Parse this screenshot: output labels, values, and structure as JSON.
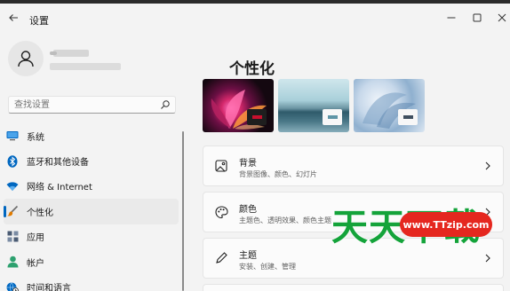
{
  "window": {
    "title": "设置",
    "back_icon": "back-arrow-icon",
    "minimize_icon": "minimize-icon",
    "maximize_icon": "maximize-icon",
    "close_icon": "close-icon"
  },
  "search": {
    "placeholder": "查找设置",
    "icon": "search-icon"
  },
  "sidebar": {
    "items": [
      {
        "label": "系统",
        "icon": "monitor-icon",
        "color": "#0067c0"
      },
      {
        "label": "蓝牙和其他设备",
        "icon": "bluetooth-icon",
        "color": "#0067c0"
      },
      {
        "label": "网络 & Internet",
        "icon": "wifi-icon",
        "color": "#0067c0"
      },
      {
        "label": "个性化",
        "icon": "brush-icon",
        "color": "#e07b00",
        "active": true
      },
      {
        "label": "应用",
        "icon": "apps-icon",
        "color": "#4a5b73"
      },
      {
        "label": "帐户",
        "icon": "person-icon",
        "color": "#2da16f"
      },
      {
        "label": "时间和语言",
        "icon": "globe-clock-icon",
        "color": "#0067c0"
      }
    ]
  },
  "main": {
    "title": "个性化",
    "themes": [
      {
        "name": "theme-bloom",
        "accent": "#c8102e"
      },
      {
        "name": "theme-lake",
        "accent": "#5e95a6"
      },
      {
        "name": "theme-flow",
        "accent": "#3f4f5f"
      }
    ],
    "cards": [
      {
        "title": "背景",
        "subtitle": "背景图像、颜色、幻灯片",
        "icon": "picture-icon"
      },
      {
        "title": "颜色",
        "subtitle": "主题色、透明效果、颜色主题",
        "icon": "palette-icon"
      },
      {
        "title": "主题",
        "subtitle": "安装、创建、管理",
        "icon": "pen-icon"
      }
    ]
  },
  "watermark": {
    "text": "天天下载",
    "url": "www.TTzip.com"
  },
  "colors": {
    "accent": "#0067c0",
    "background": "#f3f3f3",
    "watermark_green": "#14a33a",
    "watermark_red": "#e5271f"
  }
}
